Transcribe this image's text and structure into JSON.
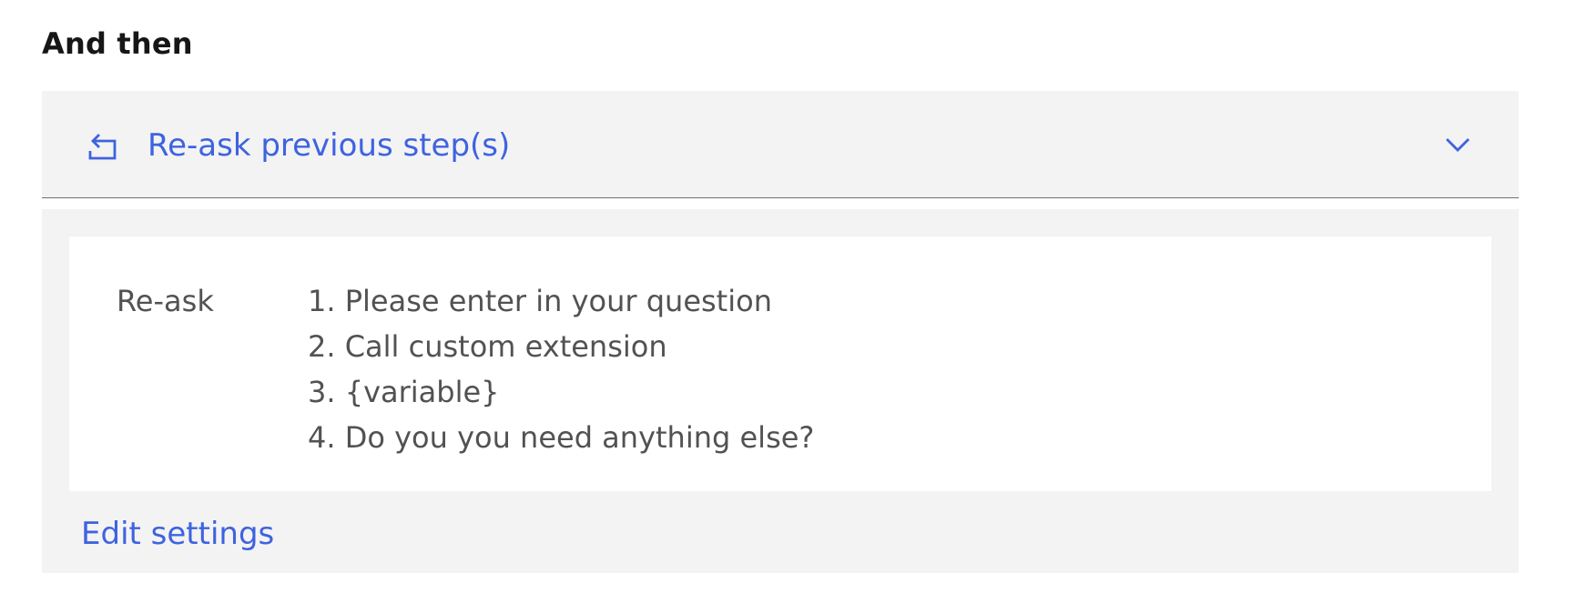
{
  "section": {
    "title": "And then"
  },
  "dropdown": {
    "label": "Re-ask previous step(s)",
    "icon": "return-arrow-icon",
    "toggle_icon": "chevron-down-icon",
    "accent_color": "#3e63e0"
  },
  "details": {
    "label": "Re-ask",
    "steps": [
      "1. Please enter in your question",
      "2. Call custom extension",
      "3. {variable}",
      "4. Do you you need anything else?"
    ]
  },
  "actions": {
    "edit_label": "Edit settings"
  }
}
